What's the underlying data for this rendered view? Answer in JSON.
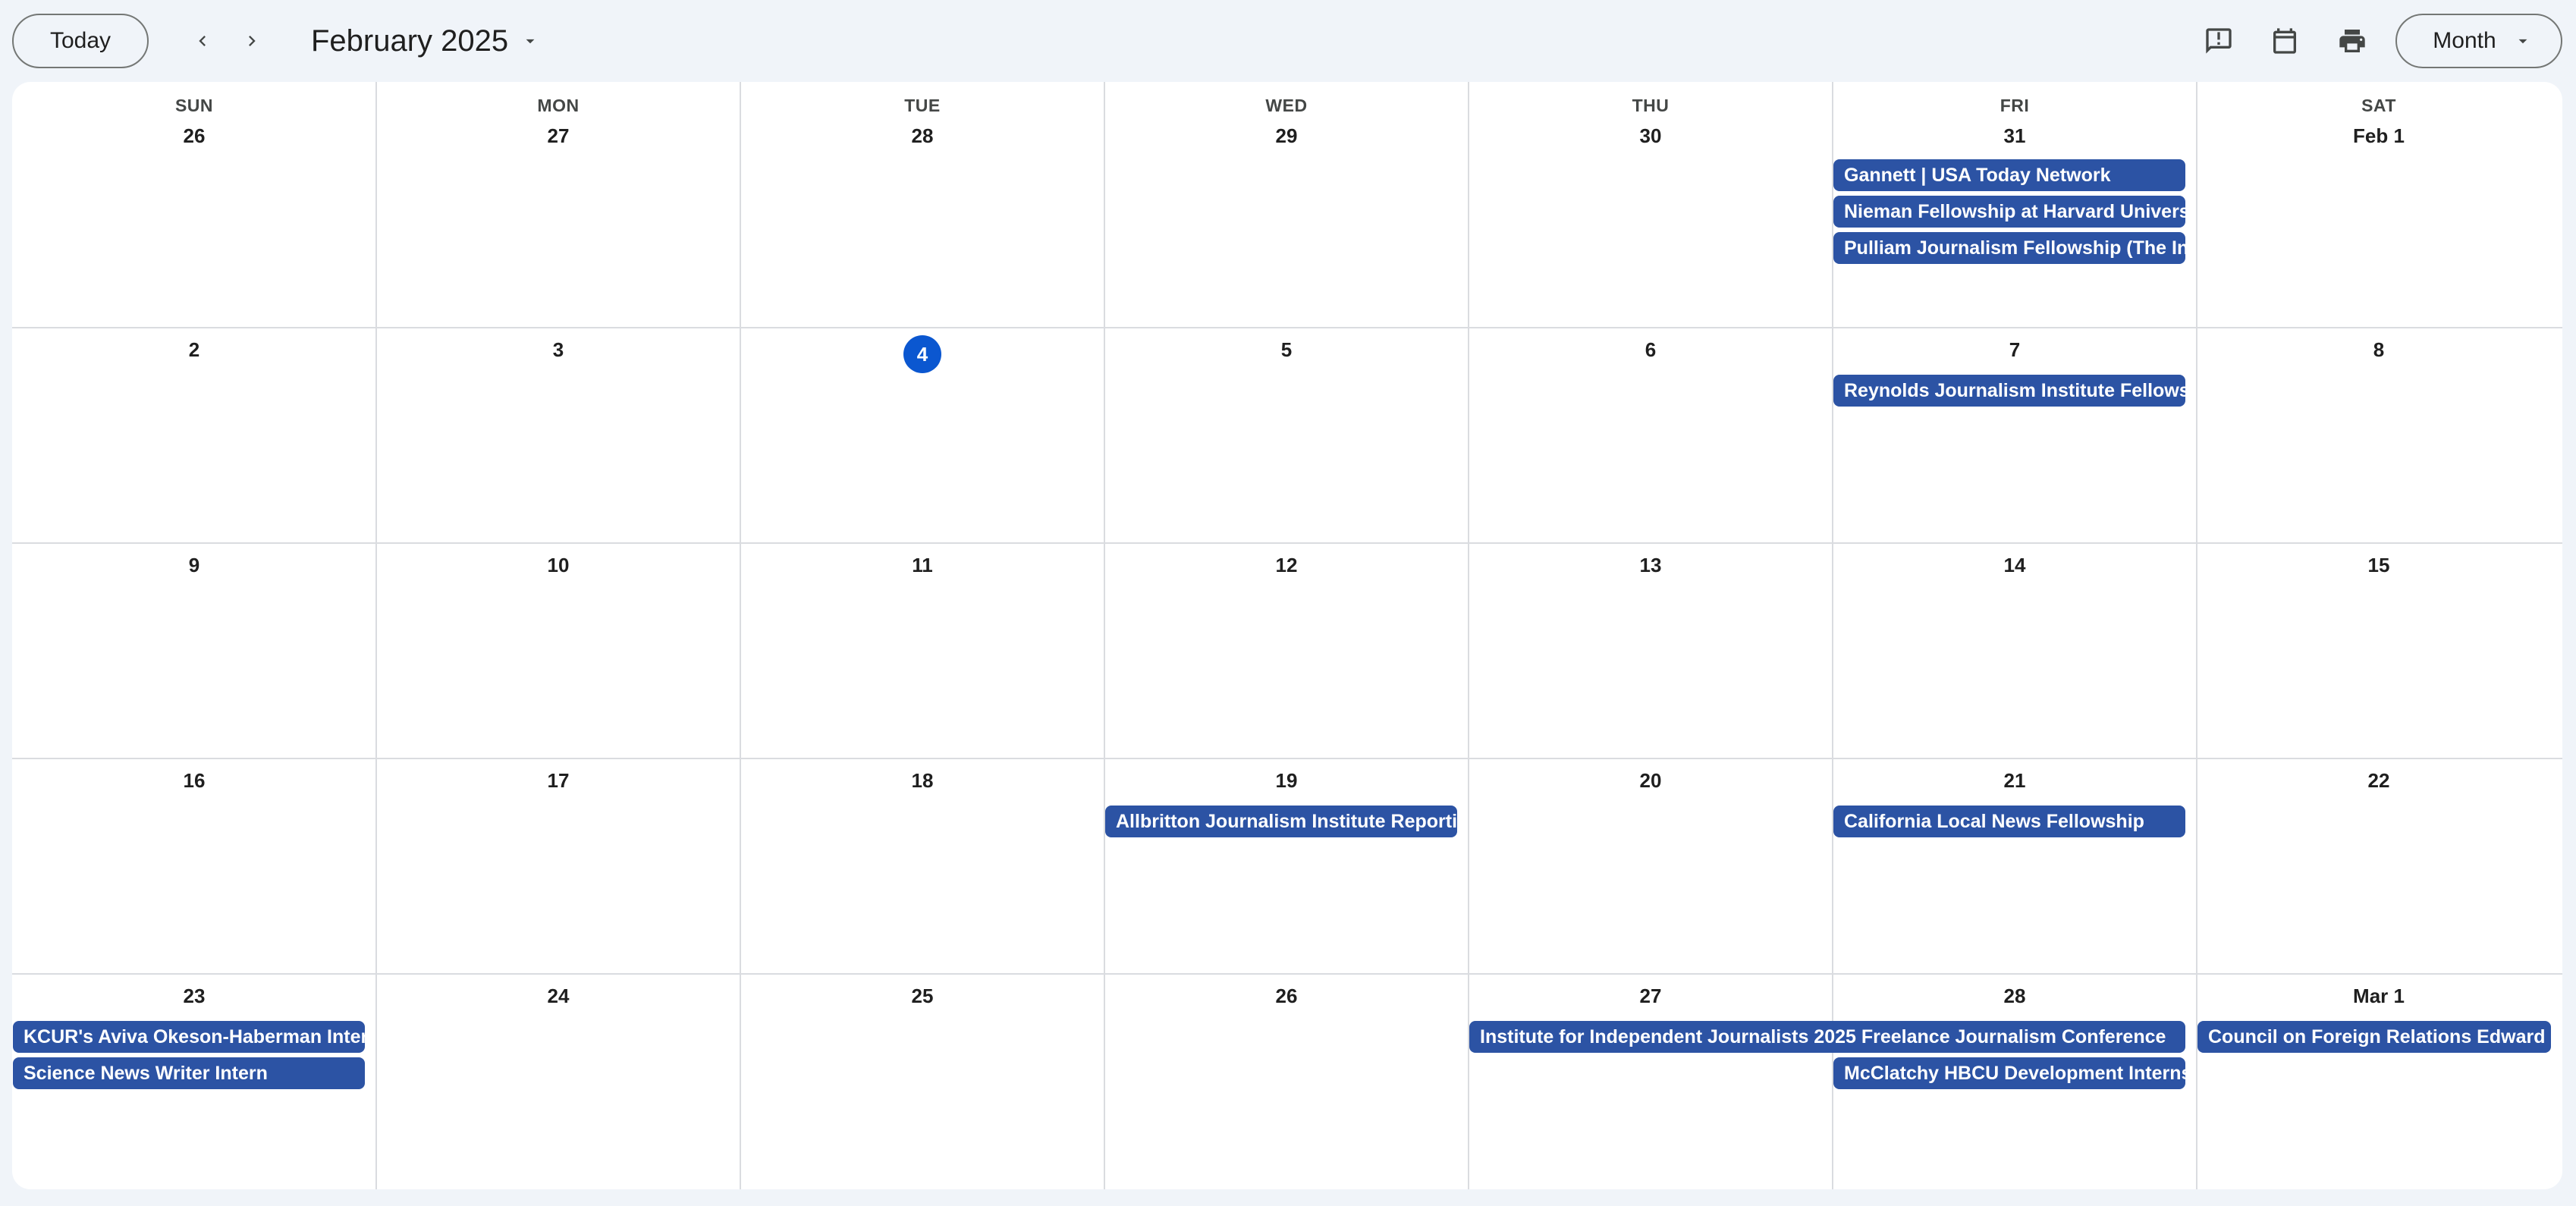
{
  "toolbar": {
    "today_label": "Today",
    "month_title": "February 2025",
    "view_label": "Month",
    "icons": {
      "prev": "chevron-left-icon",
      "next": "chevron-right-icon",
      "title_dropdown": "caret-down-icon",
      "feedback": "feedback-icon",
      "calendar": "calendar-icon",
      "print": "print-icon",
      "view_dropdown": "caret-down-icon"
    }
  },
  "weekdays": [
    "SUN",
    "MON",
    "TUE",
    "WED",
    "THU",
    "FRI",
    "SAT"
  ],
  "weeks": [
    [
      "26",
      "27",
      "28",
      "29",
      "30",
      "31",
      "Feb 1"
    ],
    [
      "2",
      "3",
      "4",
      "5",
      "6",
      "7",
      "8"
    ],
    [
      "9",
      "10",
      "11",
      "12",
      "13",
      "14",
      "15"
    ],
    [
      "16",
      "17",
      "18",
      "19",
      "20",
      "21",
      "22"
    ],
    [
      "23",
      "24",
      "25",
      "26",
      "27",
      "28",
      "Mar 1"
    ]
  ],
  "today": "4",
  "events": [
    {
      "week": 0,
      "day": 5,
      "slot": 0,
      "span": 1,
      "title": "Gannett | USA Today Network"
    },
    {
      "week": 0,
      "day": 5,
      "slot": 1,
      "span": 1,
      "title": "Nieman Fellowship at Harvard University"
    },
    {
      "week": 0,
      "day": 5,
      "slot": 2,
      "span": 1,
      "title": "Pulliam Journalism Fellowship (The Indianapolis Star)"
    },
    {
      "week": 1,
      "day": 5,
      "slot": 0,
      "span": 1,
      "title": "Reynolds Journalism Institute Fellowship"
    },
    {
      "week": 3,
      "day": 3,
      "slot": 0,
      "span": 1,
      "title": "Allbritton Journalism Institute Reporting"
    },
    {
      "week": 3,
      "day": 5,
      "slot": 0,
      "span": 1,
      "title": "California Local News Fellowship"
    },
    {
      "week": 4,
      "day": 0,
      "slot": 0,
      "span": 1,
      "title": "KCUR's Aviva Okeson-Haberman Internship"
    },
    {
      "week": 4,
      "day": 0,
      "slot": 1,
      "span": 1,
      "title": "Science News Writer Intern"
    },
    {
      "week": 4,
      "day": 4,
      "slot": 0,
      "span": 2,
      "title": "Institute for Independent Journalists 2025 Freelance Journalism Conference"
    },
    {
      "week": 4,
      "day": 5,
      "slot": 1,
      "span": 1,
      "title": "McClatchy HBCU Development Internship"
    },
    {
      "week": 4,
      "day": 6,
      "slot": 0,
      "span": 1,
      "title": "Council on Foreign Relations Edward R. Murrow Press Fellowship"
    }
  ],
  "colors": {
    "event_bg": "#2c53a4",
    "today_bg": "#0b57d0",
    "page_bg": "#f0f4f9"
  }
}
